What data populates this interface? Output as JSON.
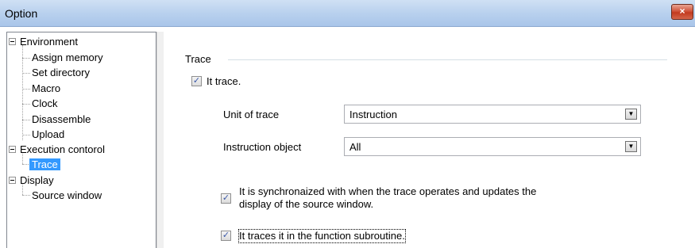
{
  "window": {
    "title": "Option",
    "close_icon": "×"
  },
  "tree": {
    "nodes": [
      {
        "label": "Environment",
        "level": 0,
        "expanded": true
      },
      {
        "label": "Assign memory",
        "level": 1
      },
      {
        "label": "Set directory",
        "level": 1
      },
      {
        "label": "Macro",
        "level": 1
      },
      {
        "label": "Clock",
        "level": 1
      },
      {
        "label": "Disassemble",
        "level": 1
      },
      {
        "label": "Upload",
        "level": 1
      },
      {
        "label": "Execution contorol",
        "level": 0,
        "expanded": true
      },
      {
        "label": "Trace",
        "level": 1,
        "selected": true
      },
      {
        "label": "Display",
        "level": 0,
        "expanded": true
      },
      {
        "label": "Source window",
        "level": 1
      }
    ]
  },
  "trace": {
    "group_title": "Trace",
    "it_trace": {
      "label": "It trace.",
      "checked": true
    },
    "unit_of_trace": {
      "label": "Unit of trace",
      "value": "Instruction"
    },
    "instruction_object": {
      "label": "Instruction object",
      "value": "All"
    },
    "sync": {
      "line1": "It is synchronaized with when the trace operates and updates the",
      "line2": "display of the source window.",
      "checked": true
    },
    "function_subroutine": {
      "label": "It traces it in the function subroutine.",
      "checked": true
    }
  },
  "glyphs": {
    "check": "✓",
    "dropdown": "▼"
  }
}
